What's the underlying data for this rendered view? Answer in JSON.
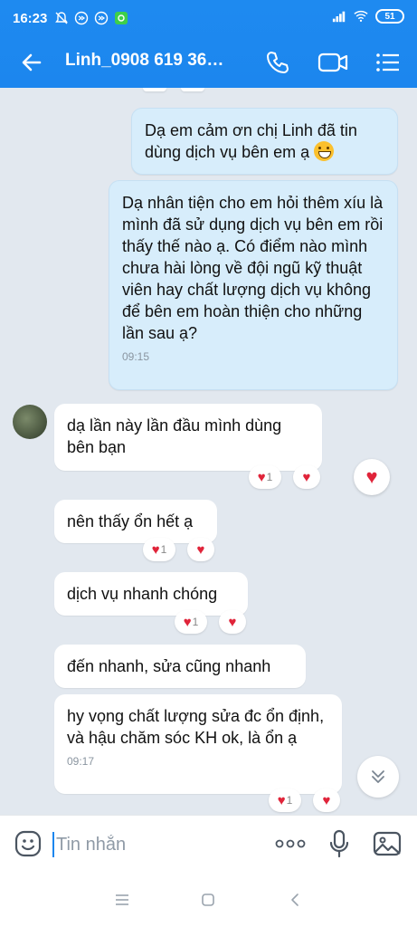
{
  "status": {
    "time": "16:23",
    "battery": "51"
  },
  "header": {
    "contact_name": "Linh_0908 619 36…"
  },
  "messages": [
    {
      "direction": "out",
      "text": "Dạ em cảm ơn chị Linh đã tin dùng dịch vụ bên em ạ"
    },
    {
      "direction": "out",
      "text": "Dạ nhân tiện cho em hỏi thêm xíu là mình đã sử dụng dịch vụ bên em rồi thấy thế nào ạ. Có điểm nào mình chưa hài lòng về đội ngũ kỹ thuật viên hay chất lượng dịch vụ không để bên em hoàn thiện cho những lần sau ạ?",
      "time": "09:15"
    },
    {
      "direction": "in",
      "text": "dạ lần này lần đầu mình dùng bên bạn",
      "reaction_count": "1"
    },
    {
      "direction": "in",
      "text": "nên thấy ổn hết ạ",
      "reaction_count": "1"
    },
    {
      "direction": "in",
      "text": "dịch vụ nhanh chóng",
      "reaction_count": "1"
    },
    {
      "direction": "in",
      "text": "đến nhanh, sửa cũng nhanh"
    },
    {
      "direction": "in",
      "text": "hy vọng chất lượng sửa đc ổn định, và hậu chăm sóc KH ok, là ổn ạ",
      "time": "09:17",
      "reaction_count": "1"
    }
  ],
  "composer": {
    "placeholder": "Tin nhắn"
  },
  "icons": {
    "back": "arrow-left-icon",
    "call": "phone-icon",
    "video": "video-camera-icon",
    "menu": "list-menu-icon",
    "sticker": "sticker-icon",
    "more": "more-dots-icon",
    "mic": "microphone-icon",
    "image": "image-icon",
    "scroll": "chevron-double-down-icon",
    "reaction": "heart-icon"
  },
  "colors": {
    "accent": "#1c86ee",
    "chat_bg": "#e2e8ef",
    "outgoing_bubble": "#d7edfb",
    "heart": "#e0243a"
  }
}
